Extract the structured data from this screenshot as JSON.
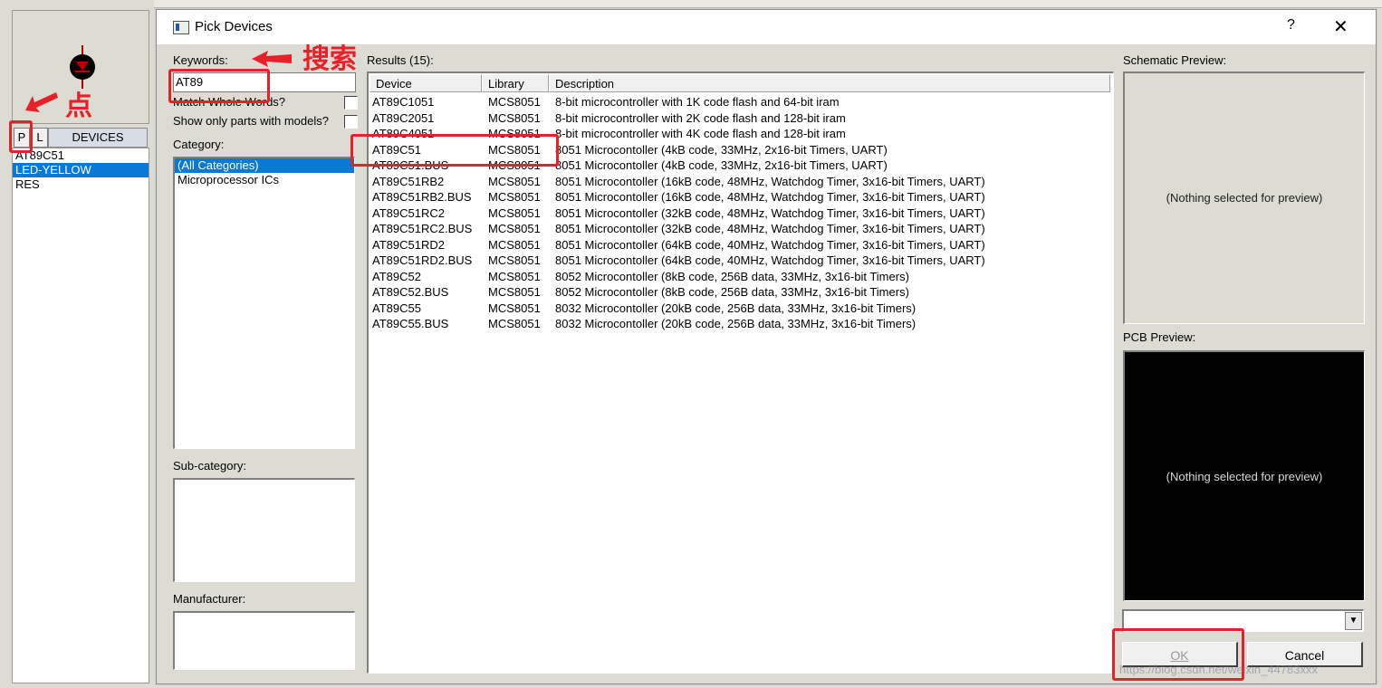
{
  "left_panel": {
    "pl_buttons": [
      "P",
      "L"
    ],
    "devices_header": "DEVICES",
    "devices": [
      {
        "name": "AT89C51",
        "selected": false
      },
      {
        "name": "LED-YELLOW",
        "selected": true
      },
      {
        "name": "RES",
        "selected": false
      }
    ]
  },
  "dialog": {
    "title": "Pick Devices",
    "help_glyph": "?",
    "close_glyph": "✕",
    "keywords_label": "Keywords:",
    "keywords_value": "AT89",
    "match_whole_words_label": "Match Whole Words?",
    "show_only_models_label": "Show only parts with models?",
    "category_label": "Category:",
    "categories": [
      {
        "name": "(All Categories)",
        "selected": true
      },
      {
        "name": "Microprocessor ICs",
        "selected": false
      }
    ],
    "subcategory_label": "Sub-category:",
    "manufacturer_label": "Manufacturer:",
    "results_label": "Results (15):",
    "columns": [
      "Device",
      "Library",
      "Description"
    ],
    "results": [
      {
        "device": "AT89C1051",
        "library": "MCS8051",
        "description": "8-bit microcontroller with 1K code flash and 64-bit iram"
      },
      {
        "device": "AT89C2051",
        "library": "MCS8051",
        "description": "8-bit microcontroller with 2K code flash and 128-bit iram"
      },
      {
        "device": "AT89C4051",
        "library": "MCS8051",
        "description": "8-bit microcontroller with 4K code flash and 128-bit iram"
      },
      {
        "device": "AT89C51",
        "library": "MCS8051",
        "description": "8051 Microcontoller (4kB code, 33MHz, 2x16-bit Timers, UART)"
      },
      {
        "device": "AT89C51.BUS",
        "library": "MCS8051",
        "description": "8051 Microcontoller (4kB code, 33MHz, 2x16-bit Timers, UART)"
      },
      {
        "device": "AT89C51RB2",
        "library": "MCS8051",
        "description": "8051 Microcontoller (16kB code, 48MHz, Watchdog Timer, 3x16-bit Timers, UART)"
      },
      {
        "device": "AT89C51RB2.BUS",
        "library": "MCS8051",
        "description": "8051 Microcontoller (16kB code, 48MHz, Watchdog Timer, 3x16-bit Timers, UART)"
      },
      {
        "device": "AT89C51RC2",
        "library": "MCS8051",
        "description": "8051 Microcontoller (32kB code, 48MHz, Watchdog Timer, 3x16-bit Timers, UART)"
      },
      {
        "device": "AT89C51RC2.BUS",
        "library": "MCS8051",
        "description": "8051 Microcontoller (32kB code, 48MHz, Watchdog Timer, 3x16-bit Timers, UART)"
      },
      {
        "device": "AT89C51RD2",
        "library": "MCS8051",
        "description": "8051 Microcontoller (64kB code, 40MHz, Watchdog Timer, 3x16-bit Timers, UART)"
      },
      {
        "device": "AT89C51RD2.BUS",
        "library": "MCS8051",
        "description": "8051 Microcontoller (64kB code, 40MHz, Watchdog Timer, 3x16-bit Timers, UART)"
      },
      {
        "device": "AT89C52",
        "library": "MCS8051",
        "description": "8052 Microcontoller (8kB code, 256B data, 33MHz, 3x16-bit Timers)"
      },
      {
        "device": "AT89C52.BUS",
        "library": "MCS8051",
        "description": "8052 Microcontoller (8kB code, 256B data, 33MHz, 3x16-bit Timers)"
      },
      {
        "device": "AT89C55",
        "library": "MCS8051",
        "description": "8032 Microcontoller (20kB code, 256B data, 33MHz, 3x16-bit Timers)"
      },
      {
        "device": "AT89C55.BUS",
        "library": "MCS8051",
        "description": "8032 Microcontoller (20kB code, 256B data, 33MHz, 3x16-bit Timers)"
      }
    ],
    "schematic_preview_label": "Schematic Preview:",
    "schematic_preview_msg": "(Nothing selected for preview)",
    "pcb_preview_label": "PCB Preview:",
    "pcb_preview_msg": "(Nothing selected for preview)",
    "dropdown_value": "",
    "ok_label": "OK",
    "cancel_label": "Cancel"
  },
  "annotations": {
    "search_note": "搜索",
    "click_note": "点",
    "color": "#e8202a"
  },
  "watermark": "https://blog.csdn.net/weixin_44783xxx"
}
